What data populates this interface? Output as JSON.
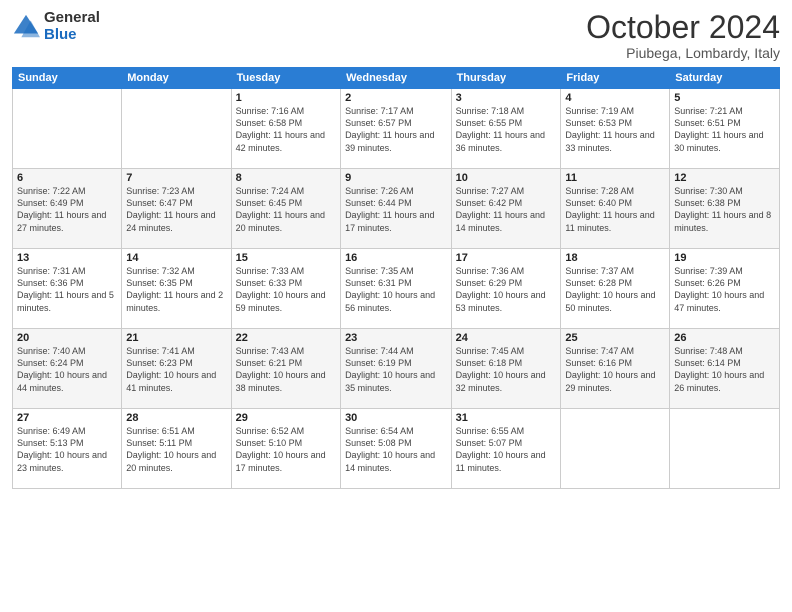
{
  "logo": {
    "general": "General",
    "blue": "Blue"
  },
  "header": {
    "month": "October 2024",
    "location": "Piubega, Lombardy, Italy"
  },
  "weekdays": [
    "Sunday",
    "Monday",
    "Tuesday",
    "Wednesday",
    "Thursday",
    "Friday",
    "Saturday"
  ],
  "weeks": [
    [
      {
        "day": "",
        "info": ""
      },
      {
        "day": "",
        "info": ""
      },
      {
        "day": "1",
        "info": "Sunrise: 7:16 AM\nSunset: 6:58 PM\nDaylight: 11 hours and 42 minutes."
      },
      {
        "day": "2",
        "info": "Sunrise: 7:17 AM\nSunset: 6:57 PM\nDaylight: 11 hours and 39 minutes."
      },
      {
        "day": "3",
        "info": "Sunrise: 7:18 AM\nSunset: 6:55 PM\nDaylight: 11 hours and 36 minutes."
      },
      {
        "day": "4",
        "info": "Sunrise: 7:19 AM\nSunset: 6:53 PM\nDaylight: 11 hours and 33 minutes."
      },
      {
        "day": "5",
        "info": "Sunrise: 7:21 AM\nSunset: 6:51 PM\nDaylight: 11 hours and 30 minutes."
      }
    ],
    [
      {
        "day": "6",
        "info": "Sunrise: 7:22 AM\nSunset: 6:49 PM\nDaylight: 11 hours and 27 minutes."
      },
      {
        "day": "7",
        "info": "Sunrise: 7:23 AM\nSunset: 6:47 PM\nDaylight: 11 hours and 24 minutes."
      },
      {
        "day": "8",
        "info": "Sunrise: 7:24 AM\nSunset: 6:45 PM\nDaylight: 11 hours and 20 minutes."
      },
      {
        "day": "9",
        "info": "Sunrise: 7:26 AM\nSunset: 6:44 PM\nDaylight: 11 hours and 17 minutes."
      },
      {
        "day": "10",
        "info": "Sunrise: 7:27 AM\nSunset: 6:42 PM\nDaylight: 11 hours and 14 minutes."
      },
      {
        "day": "11",
        "info": "Sunrise: 7:28 AM\nSunset: 6:40 PM\nDaylight: 11 hours and 11 minutes."
      },
      {
        "day": "12",
        "info": "Sunrise: 7:30 AM\nSunset: 6:38 PM\nDaylight: 11 hours and 8 minutes."
      }
    ],
    [
      {
        "day": "13",
        "info": "Sunrise: 7:31 AM\nSunset: 6:36 PM\nDaylight: 11 hours and 5 minutes."
      },
      {
        "day": "14",
        "info": "Sunrise: 7:32 AM\nSunset: 6:35 PM\nDaylight: 11 hours and 2 minutes."
      },
      {
        "day": "15",
        "info": "Sunrise: 7:33 AM\nSunset: 6:33 PM\nDaylight: 10 hours and 59 minutes."
      },
      {
        "day": "16",
        "info": "Sunrise: 7:35 AM\nSunset: 6:31 PM\nDaylight: 10 hours and 56 minutes."
      },
      {
        "day": "17",
        "info": "Sunrise: 7:36 AM\nSunset: 6:29 PM\nDaylight: 10 hours and 53 minutes."
      },
      {
        "day": "18",
        "info": "Sunrise: 7:37 AM\nSunset: 6:28 PM\nDaylight: 10 hours and 50 minutes."
      },
      {
        "day": "19",
        "info": "Sunrise: 7:39 AM\nSunset: 6:26 PM\nDaylight: 10 hours and 47 minutes."
      }
    ],
    [
      {
        "day": "20",
        "info": "Sunrise: 7:40 AM\nSunset: 6:24 PM\nDaylight: 10 hours and 44 minutes."
      },
      {
        "day": "21",
        "info": "Sunrise: 7:41 AM\nSunset: 6:23 PM\nDaylight: 10 hours and 41 minutes."
      },
      {
        "day": "22",
        "info": "Sunrise: 7:43 AM\nSunset: 6:21 PM\nDaylight: 10 hours and 38 minutes."
      },
      {
        "day": "23",
        "info": "Sunrise: 7:44 AM\nSunset: 6:19 PM\nDaylight: 10 hours and 35 minutes."
      },
      {
        "day": "24",
        "info": "Sunrise: 7:45 AM\nSunset: 6:18 PM\nDaylight: 10 hours and 32 minutes."
      },
      {
        "day": "25",
        "info": "Sunrise: 7:47 AM\nSunset: 6:16 PM\nDaylight: 10 hours and 29 minutes."
      },
      {
        "day": "26",
        "info": "Sunrise: 7:48 AM\nSunset: 6:14 PM\nDaylight: 10 hours and 26 minutes."
      }
    ],
    [
      {
        "day": "27",
        "info": "Sunrise: 6:49 AM\nSunset: 5:13 PM\nDaylight: 10 hours and 23 minutes."
      },
      {
        "day": "28",
        "info": "Sunrise: 6:51 AM\nSunset: 5:11 PM\nDaylight: 10 hours and 20 minutes."
      },
      {
        "day": "29",
        "info": "Sunrise: 6:52 AM\nSunset: 5:10 PM\nDaylight: 10 hours and 17 minutes."
      },
      {
        "day": "30",
        "info": "Sunrise: 6:54 AM\nSunset: 5:08 PM\nDaylight: 10 hours and 14 minutes."
      },
      {
        "day": "31",
        "info": "Sunrise: 6:55 AM\nSunset: 5:07 PM\nDaylight: 10 hours and 11 minutes."
      },
      {
        "day": "",
        "info": ""
      },
      {
        "day": "",
        "info": ""
      }
    ]
  ]
}
